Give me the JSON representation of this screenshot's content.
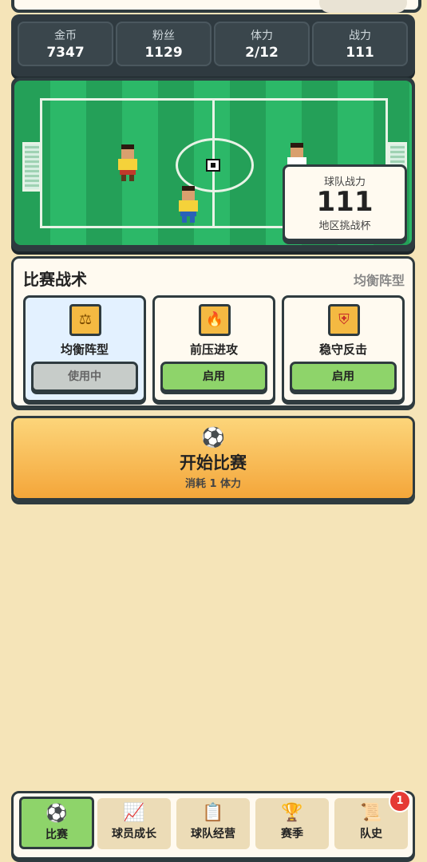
{
  "stats": [
    {
      "label": "金币",
      "value": "7347"
    },
    {
      "label": "粉丝",
      "value": "1129"
    },
    {
      "label": "体力",
      "value": "2/12"
    },
    {
      "label": "战力",
      "value": "111"
    }
  ],
  "team_power": {
    "title": "球队战力",
    "value": "111",
    "league": "地区挑战杯"
  },
  "tactics": {
    "title": "比赛战术",
    "current": "均衡阵型",
    "options": [
      {
        "name": "均衡阵型",
        "button": "使用中",
        "icon": "balance-icon"
      },
      {
        "name": "前压进攻",
        "button": "启用",
        "icon": "fire-icon"
      },
      {
        "name": "稳守反击",
        "button": "启用",
        "icon": "shield-icon"
      }
    ]
  },
  "start_match": {
    "icon": "soccer-ball-icon",
    "label": "开始比赛",
    "cost": "消耗 1 体力"
  },
  "nav": {
    "items": [
      {
        "label": "比赛",
        "icon": "soccer-ball-icon"
      },
      {
        "label": "球员成长",
        "icon": "chart-up-icon"
      },
      {
        "label": "球队经营",
        "icon": "clipboard-icon"
      },
      {
        "label": "赛季",
        "icon": "trophy-icon"
      },
      {
        "label": "队史",
        "icon": "scroll-icon"
      }
    ],
    "badge_count": "1"
  },
  "colors": {
    "accent_green": "#8ed46a",
    "accent_orange": "#f4a63a",
    "dark": "#2f3b3f"
  }
}
